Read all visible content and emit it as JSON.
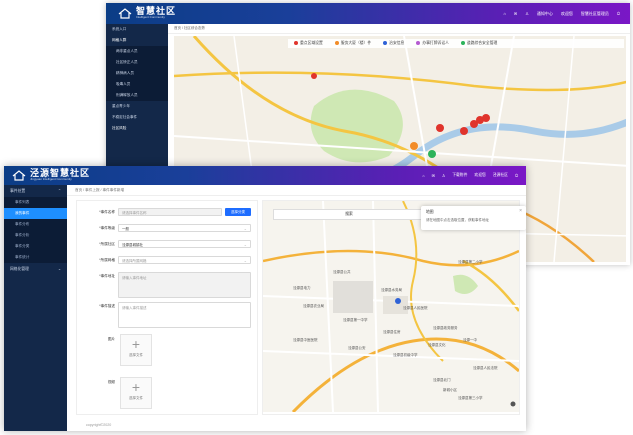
{
  "back_window": {
    "logo_title": "智慧社区",
    "logo_sub": "Intelligent Community",
    "header_links": [
      "通知中心",
      "欢迎您",
      "智慧社区管理员"
    ],
    "breadcrumb": "首页 / 社区综合态势",
    "sidebar": [
      {
        "label": "系统入口",
        "sub": false
      },
      {
        "label": "网格人群",
        "sub": false,
        "active": true
      },
      {
        "label": "两非重点人员",
        "sub": true
      },
      {
        "label": "社区矫正人员",
        "sub": true
      },
      {
        "label": "精神病人员",
        "sub": true
      },
      {
        "label": "吸毒人员",
        "sub": true
      },
      {
        "label": "刑满释放人员",
        "sub": true
      },
      {
        "label": "重点青少年",
        "sub": false
      },
      {
        "label": "不稳定社会事件",
        "sub": false
      },
      {
        "label": "社区风险",
        "sub": false,
        "active": true
      }
    ],
    "legend": [
      {
        "label": "重点区域设置",
        "color": "#e0342c"
      },
      {
        "label": "服务大厦（楼）件",
        "color": "#f28c28"
      },
      {
        "label": "治安信息",
        "color": "#2f62d6"
      },
      {
        "label": "办事打牌诉讼人",
        "color": "#b55bd1"
      },
      {
        "label": "道路综合安全管理",
        "color": "#2db35b"
      }
    ]
  },
  "front_window": {
    "logo_title": "泾源智慧社区",
    "logo_sub": "Jingyuan Intelligent Community",
    "header_links": [
      "下载附件",
      "欢迎您",
      "泾源社区"
    ],
    "breadcrumb": "首页 / 事件上报 / 事件事件新增",
    "sidebar": {
      "group1": "事件处置",
      "items": [
        "事件列表",
        "我的事件",
        "事件分布",
        "事件分析",
        "事件分类",
        "事件统计",
        "事件评价"
      ],
      "active_index": 1,
      "group2": "网格化管理"
    },
    "form": {
      "fields": [
        {
          "label": "*事件名称",
          "placeholder": "请选择事件名称",
          "button": "选择分类"
        },
        {
          "label": "*事件等级",
          "value": "一般"
        },
        {
          "label": "*所属社区",
          "value": "泾源县城镇社"
        },
        {
          "label": "*所属网格",
          "placeholder": "请选择所属网格"
        },
        {
          "label": "*事件地址",
          "placeholder": "请输入事件地址"
        },
        {
          "label": "*事件描述",
          "placeholder": "请输入事件描述"
        }
      ],
      "image_label": "图片",
      "video_label": "视频",
      "upload_text": "选择文件"
    },
    "map": {
      "search_placeholder": "搜索",
      "info_title": "地图",
      "info_content": "请在地图中点击选取位置，获取事件地址",
      "poi": [
        "泾源县公共",
        "泾源县电力",
        "泾源县水务局",
        "泾源县人民医院",
        "泾源县第一中学",
        "泾源县政务服务",
        "泾源县中医医院",
        "泾源县住房",
        "泾源县文化",
        "泾源县公安",
        "泾源一中",
        "泾源县初级中学",
        "泾源县第二小学",
        "泾源县农业局",
        "泾源县人民法院",
        "泾源县第三小学",
        "泾源县北门",
        "新城小区"
      ]
    },
    "footer": "copyright©2020"
  }
}
